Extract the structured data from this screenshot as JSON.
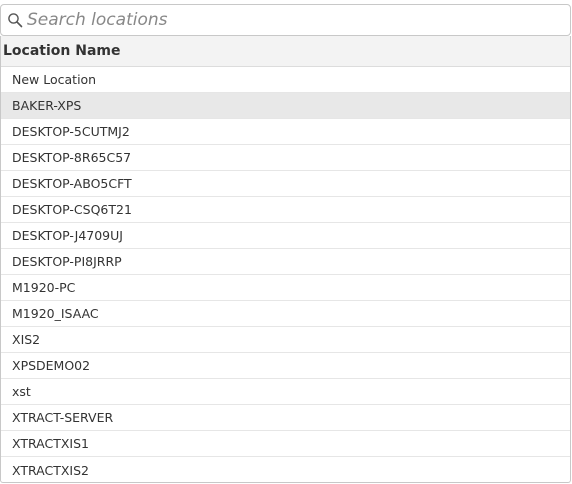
{
  "search": {
    "placeholder": "Search locations",
    "value": ""
  },
  "table": {
    "header": "Location Name",
    "selected_index": 1,
    "items": [
      "New Location",
      "BAKER-XPS",
      "DESKTOP-5CUTMJ2",
      "DESKTOP-8R65C57",
      "DESKTOP-ABO5CFT",
      "DESKTOP-CSQ6T21",
      "DESKTOP-J4709UJ",
      "DESKTOP-PI8JRRP",
      "M1920-PC",
      "M1920_ISAAC",
      "XIS2",
      "XPSDEMO02",
      "xst",
      "XTRACT-SERVER",
      "XTRACTXIS1",
      "XTRACTXIS2"
    ]
  },
  "icons": {
    "search": "search-icon"
  }
}
